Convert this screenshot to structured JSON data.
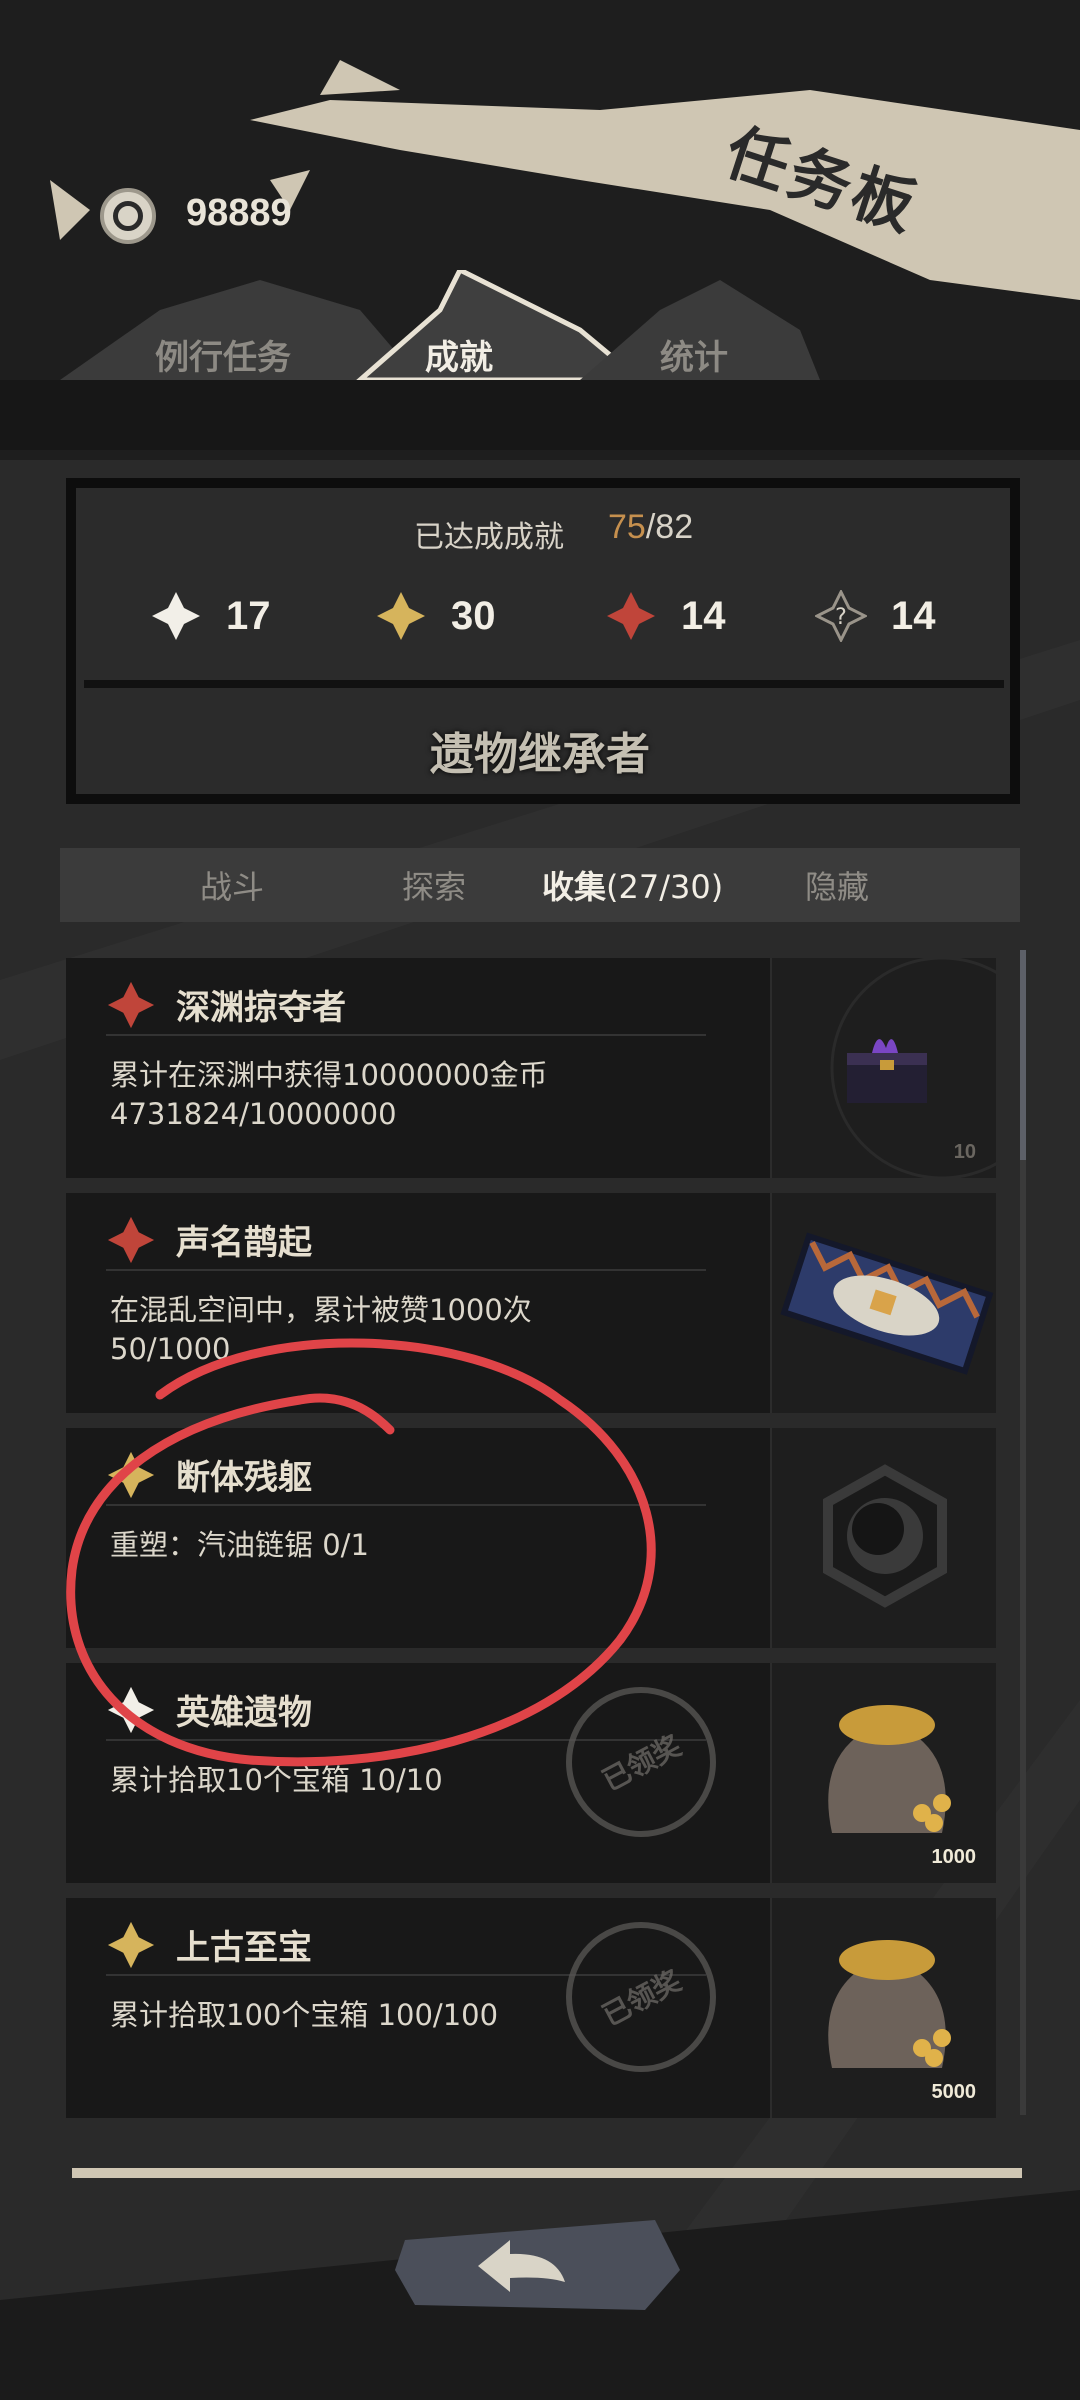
{
  "header": {
    "title": "任务板",
    "coins": "98889"
  },
  "tabs": [
    {
      "label": "例行任务"
    },
    {
      "label": "成就"
    },
    {
      "label": "统计"
    }
  ],
  "summary": {
    "label": "已达成成就",
    "done": "75",
    "separator": "/",
    "total": "82",
    "tiers": [
      {
        "icon": "white-diamond-icon",
        "count": "17",
        "color": "#f2efe8"
      },
      {
        "icon": "gold-diamond-icon",
        "count": "30",
        "color": "#d6b45c"
      },
      {
        "icon": "red-diamond-icon",
        "count": "14",
        "color": "#c0453a"
      },
      {
        "icon": "hidden-diamond-icon",
        "count": "14",
        "color": "#9a948a"
      }
    ],
    "earned_title": "遗物继承者"
  },
  "subtabs": [
    {
      "label": "战斗"
    },
    {
      "label": "探索"
    },
    {
      "label": "收集",
      "count": "(27/30)"
    },
    {
      "label": "隐藏"
    }
  ],
  "cards": [
    {
      "title": "深渊掠夺者",
      "tier": "red",
      "desc1": "累计在深渊中获得10000000金币",
      "desc2": "4731824/10000000",
      "thumb": "chest-icon",
      "qty": "10"
    },
    {
      "title": "声名鹊起",
      "tier": "red",
      "desc1": "在混乱空间中，累计被赞1000次",
      "desc2": "50/1000",
      "thumb": "thumbs-up-banner-icon",
      "qty": ""
    },
    {
      "title": "断体残躯",
      "tier": "gold",
      "desc1": "重塑：汽油链锯 0/1",
      "desc2": "",
      "thumb": "hex-emblem-icon",
      "qty": ""
    },
    {
      "title": "英雄遗物",
      "tier": "white",
      "desc1": "累计拾取10个宝箱 10/10",
      "desc2": "",
      "thumb": "gold-sack-icon",
      "qty": "1000",
      "stamp": "已领奖"
    },
    {
      "title": "上古至宝",
      "tier": "gold",
      "desc1": "累计拾取100个宝箱 100/100",
      "desc2": "",
      "thumb": "gold-sack-icon",
      "qty": "5000",
      "stamp": "已领奖"
    }
  ],
  "colors": {
    "accent_gold": "#c6904e",
    "red_tier": "#c0453a",
    "gold_tier": "#d6b45c",
    "annotation_red": "#e04448"
  }
}
